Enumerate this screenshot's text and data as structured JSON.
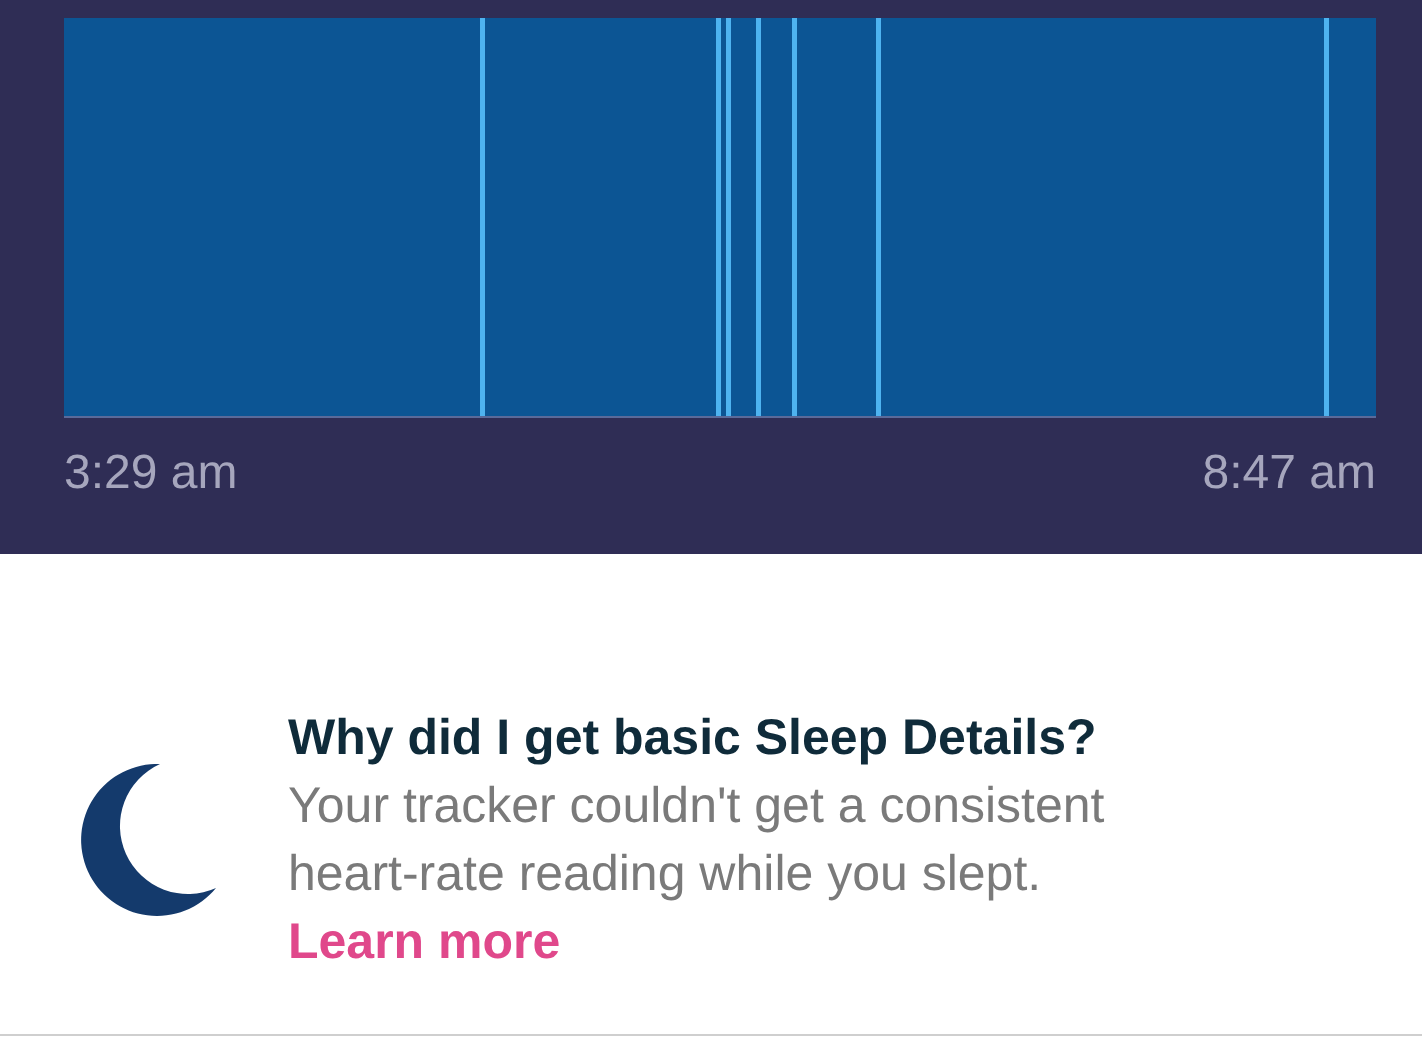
{
  "sleep_chart": {
    "start_time": "3:29 am",
    "end_time": "8:47 am"
  },
  "info": {
    "title": "Why did I get basic Sleep Details?",
    "body": "Your tracker couldn't get a consistent heart-rate reading while you slept.",
    "link": "Learn more"
  }
}
